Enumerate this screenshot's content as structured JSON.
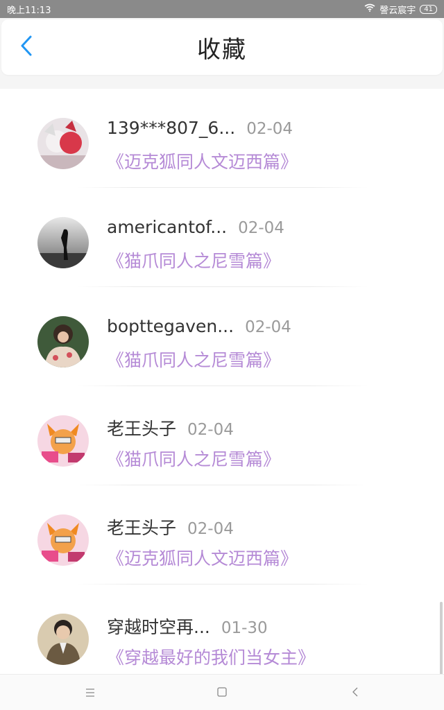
{
  "status": {
    "time": "晚上11:13",
    "carrier": "謦云宸宇",
    "battery": "41"
  },
  "header": {
    "title": "收藏"
  },
  "favorites": [
    {
      "user": "139***807_6...",
      "date": "02-04",
      "book": "《迈克狐同人文迈西篇》"
    },
    {
      "user": "americantof...",
      "date": "02-04",
      "book": "《猫爪同人之尼雪篇》"
    },
    {
      "user": "bopttegaven...",
      "date": "02-04",
      "book": "《猫爪同人之尼雪篇》"
    },
    {
      "user": "老王头子",
      "date": "02-04",
      "book": "《猫爪同人之尼雪篇》"
    },
    {
      "user": "老王头子",
      "date": "02-04",
      "book": "《迈克狐同人文迈西篇》"
    },
    {
      "user": "穿越时空再...",
      "date": "01-30",
      "book": "《穿越最好的我们当女主》"
    }
  ],
  "colors": {
    "accent": "#2196f3",
    "book_title": "#b58ad6",
    "date": "#9a9a9a"
  },
  "icons": {
    "back": "chevron-left-icon",
    "menu": "menu-icon",
    "home": "home-icon",
    "nav_back": "nav-back-icon"
  }
}
